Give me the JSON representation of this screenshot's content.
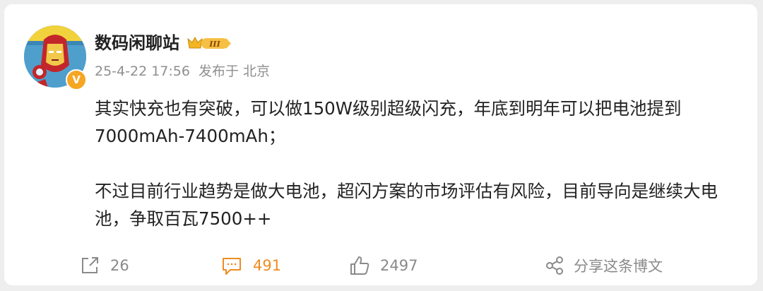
{
  "post": {
    "author": "数码闲聊站",
    "level_badge_text": "III",
    "date": "25-4-22 17:56",
    "location": "发布于 北京",
    "verified_mark": "V",
    "paragraphs": [
      "其实快充也有突破，可以做150W级别超级闪充，年底到明年可以把电池提到7000mAh-7400mAh；",
      "不过目前行业趋势是做大电池，超闪方案的市场评估有风险，目前导向是继续大电池，争取百瓦7500++"
    ]
  },
  "actions": {
    "share_count": "26",
    "comment_count": "491",
    "like_count": "2497",
    "share_post_label": "分享这条博文"
  },
  "colors": {
    "comment_accent": "#ee8c1f",
    "verified_badge": "#f6a623",
    "muted_text": "#8a8a8a"
  },
  "icons": [
    "share-icon",
    "comment-icon",
    "like-icon",
    "share-post-icon",
    "crown-icon",
    "verified-icon"
  ]
}
